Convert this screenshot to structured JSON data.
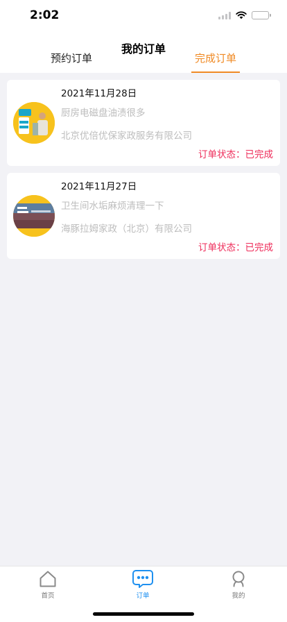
{
  "status_bar": {
    "time": "2:02"
  },
  "header": {
    "title": "我的订单",
    "tabs": [
      {
        "label": "预约订单",
        "active": false
      },
      {
        "label": "完成订单",
        "active": true
      }
    ]
  },
  "orders": [
    {
      "date": "2021年11月28日",
      "title": "厨房电磁盘油渍很多",
      "company": "北京优倍优保家政服务有限公司",
      "status": "订单状态：已完成"
    },
    {
      "date": "2021年11月27日",
      "title": "卫生间水垢麻烦清理一下",
      "company": "海豚拉姆家政（北京）有限公司",
      "status": "订单状态：已完成"
    }
  ],
  "tabbar": {
    "items": [
      {
        "label": "首页",
        "icon": "home-icon"
      },
      {
        "label": "订单",
        "icon": "chat-bubble-icon",
        "active": true
      },
      {
        "label": "我的",
        "icon": "person-icon"
      }
    ]
  },
  "colors": {
    "accent": "#f08a24",
    "status": "#ee2b59",
    "active_tab": "#1e90f0",
    "thumb_bg": "#f7c21d"
  }
}
